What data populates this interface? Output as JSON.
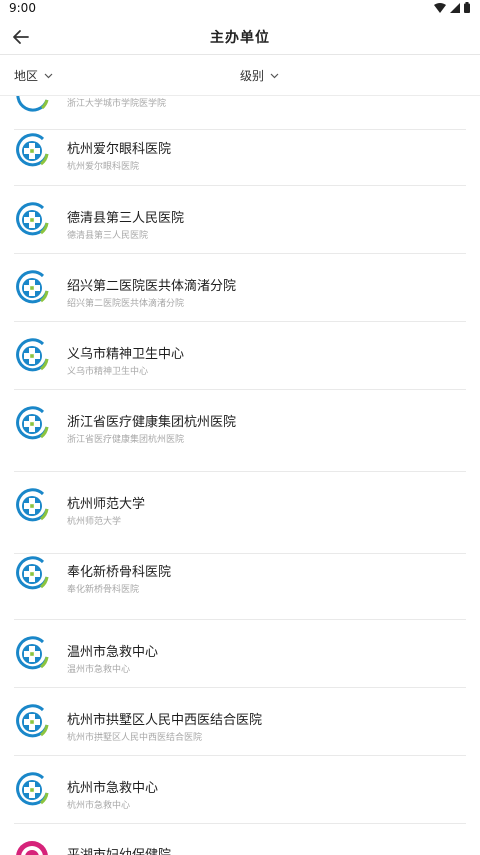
{
  "status_bar": {
    "time": "9:00",
    "icons": [
      "wifi-icon",
      "cell-signal-icon",
      "battery-icon"
    ]
  },
  "header": {
    "title": "主办单位",
    "back_icon": "arrow-left-icon"
  },
  "filters": [
    {
      "label": "地区",
      "icon": "chevron-down-icon"
    },
    {
      "label": "级别",
      "icon": "chevron-down-icon"
    }
  ],
  "list": {
    "partial_top": {
      "subtitle": "浙江大学城市学院医学院"
    },
    "items": [
      {
        "name": "杭州爱尔眼科医院",
        "subtitle": "杭州爱尔眼科医院"
      },
      {
        "name": "德清县第三人民医院",
        "subtitle": "德清县第三人民医院"
      },
      {
        "name": "绍兴第二医院医共体滴渚分院",
        "subtitle": "绍兴第二医院医共体滴渚分院"
      },
      {
        "name": "义乌市精神卫生中心",
        "subtitle": "义乌市精神卫生中心"
      },
      {
        "name": "浙江省医疗健康集团杭州医院",
        "subtitle": "浙江省医疗健康集团杭州医院"
      },
      {
        "name": "杭州师范大学",
        "subtitle": "杭州师范大学"
      },
      {
        "name": "奉化新桥骨科医院",
        "subtitle": "奉化新桥骨科医院"
      },
      {
        "name": "温州市急救中心",
        "subtitle": "温州市急救中心"
      },
      {
        "name": "杭州市拱墅区人民中西医结合医院",
        "subtitle": "杭州市拱墅区人民中西医结合医院"
      },
      {
        "name": "杭州市急救中心",
        "subtitle": "杭州市急救中心"
      },
      {
        "name": "平湖市妇幼保健院",
        "subtitle": ""
      }
    ]
  },
  "colors": {
    "logo_blue": "#1a87c9",
    "logo_green": "#8cc43f",
    "logo_pink": "#d6237a",
    "divider": "#e9e9e9",
    "subtitle": "#a8a8a8"
  }
}
